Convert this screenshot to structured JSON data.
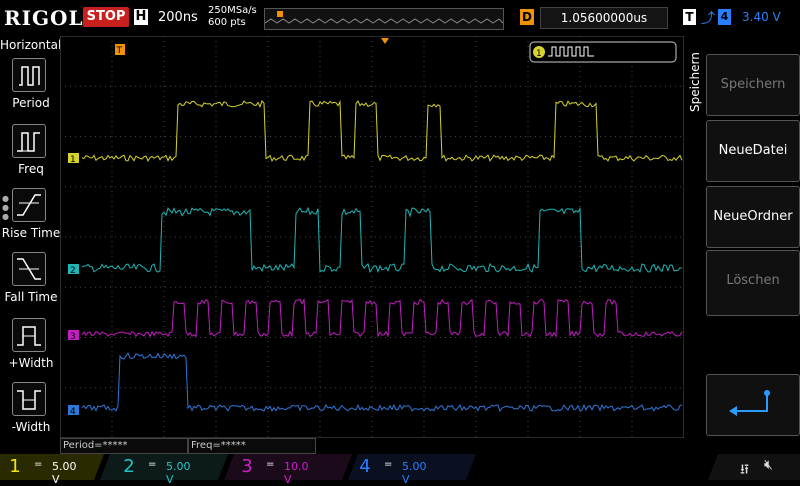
{
  "top": {
    "brand": "RIGOL",
    "run_state": "STOP",
    "h_badge": "H",
    "timebase": "200ns",
    "sample_rate": "250MSa/s",
    "points": "600 pts",
    "d_badge": "D",
    "delay": "1.05600000us",
    "t_badge": "T",
    "trig_channel": "4",
    "trig_level": "3.40 V"
  },
  "left": {
    "heading": "Horizontal",
    "items": [
      {
        "label": "Period",
        "icon": "period-icon"
      },
      {
        "label": "Freq",
        "icon": "freq-icon"
      },
      {
        "label": "Rise Time",
        "icon": "rise-time-icon"
      },
      {
        "label": "Fall Time",
        "icon": "fall-time-icon"
      },
      {
        "label": "+Width",
        "icon": "pos-width-icon"
      },
      {
        "label": "-Width",
        "icon": "neg-width-icon"
      }
    ]
  },
  "grid": {
    "markers": [
      "1",
      "2",
      "3",
      "4"
    ],
    "trigger_marker": "T",
    "legend_channel": "1"
  },
  "menu": {
    "title": "Speichern",
    "keys": [
      {
        "label": "Speichern",
        "enabled": false
      },
      {
        "label": "NeueDatei",
        "enabled": true
      },
      {
        "label": "NeueOrdner",
        "enabled": true
      },
      {
        "label": "Löschen",
        "enabled": false
      }
    ]
  },
  "readouts": {
    "period": "Period=*****",
    "freq": "Freq=*****"
  },
  "channels": [
    {
      "num": "1",
      "coupling": "=",
      "scale": "5.00 V",
      "color": "#f2e515",
      "active": true
    },
    {
      "num": "2",
      "coupling": "=",
      "scale": "5.00 V",
      "color": "#1fc7c7",
      "active": false
    },
    {
      "num": "3",
      "coupling": "=",
      "scale": "10.0 V",
      "color": "#d01fd0",
      "active": false
    },
    {
      "num": "4",
      "coupling": "=",
      "scale": "5.00 V",
      "color": "#2a7dff",
      "active": false
    }
  ],
  "colors": {
    "ch1": "#d6d32a",
    "ch2": "#1fb6b6",
    "ch3": "#c21ec2",
    "ch4": "#2f78d8",
    "stop": "#c8201e",
    "trigger": "#f39200"
  }
}
